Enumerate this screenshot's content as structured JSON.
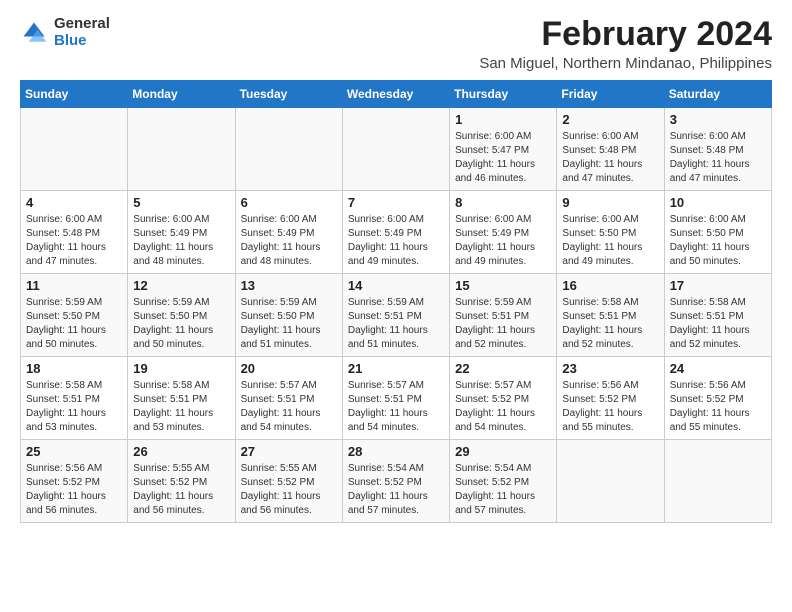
{
  "logo": {
    "general": "General",
    "blue": "Blue"
  },
  "header": {
    "title": "February 2024",
    "subtitle": "San Miguel, Northern Mindanao, Philippines"
  },
  "weekdays": [
    "Sunday",
    "Monday",
    "Tuesday",
    "Wednesday",
    "Thursday",
    "Friday",
    "Saturday"
  ],
  "weeks": [
    [
      {
        "day": "",
        "info": ""
      },
      {
        "day": "",
        "info": ""
      },
      {
        "day": "",
        "info": ""
      },
      {
        "day": "",
        "info": ""
      },
      {
        "day": "1",
        "info": "Sunrise: 6:00 AM\nSunset: 5:47 PM\nDaylight: 11 hours and 46 minutes."
      },
      {
        "day": "2",
        "info": "Sunrise: 6:00 AM\nSunset: 5:48 PM\nDaylight: 11 hours and 47 minutes."
      },
      {
        "day": "3",
        "info": "Sunrise: 6:00 AM\nSunset: 5:48 PM\nDaylight: 11 hours and 47 minutes."
      }
    ],
    [
      {
        "day": "4",
        "info": "Sunrise: 6:00 AM\nSunset: 5:48 PM\nDaylight: 11 hours and 47 minutes."
      },
      {
        "day": "5",
        "info": "Sunrise: 6:00 AM\nSunset: 5:49 PM\nDaylight: 11 hours and 48 minutes."
      },
      {
        "day": "6",
        "info": "Sunrise: 6:00 AM\nSunset: 5:49 PM\nDaylight: 11 hours and 48 minutes."
      },
      {
        "day": "7",
        "info": "Sunrise: 6:00 AM\nSunset: 5:49 PM\nDaylight: 11 hours and 49 minutes."
      },
      {
        "day": "8",
        "info": "Sunrise: 6:00 AM\nSunset: 5:49 PM\nDaylight: 11 hours and 49 minutes."
      },
      {
        "day": "9",
        "info": "Sunrise: 6:00 AM\nSunset: 5:50 PM\nDaylight: 11 hours and 49 minutes."
      },
      {
        "day": "10",
        "info": "Sunrise: 6:00 AM\nSunset: 5:50 PM\nDaylight: 11 hours and 50 minutes."
      }
    ],
    [
      {
        "day": "11",
        "info": "Sunrise: 5:59 AM\nSunset: 5:50 PM\nDaylight: 11 hours and 50 minutes."
      },
      {
        "day": "12",
        "info": "Sunrise: 5:59 AM\nSunset: 5:50 PM\nDaylight: 11 hours and 50 minutes."
      },
      {
        "day": "13",
        "info": "Sunrise: 5:59 AM\nSunset: 5:50 PM\nDaylight: 11 hours and 51 minutes."
      },
      {
        "day": "14",
        "info": "Sunrise: 5:59 AM\nSunset: 5:51 PM\nDaylight: 11 hours and 51 minutes."
      },
      {
        "day": "15",
        "info": "Sunrise: 5:59 AM\nSunset: 5:51 PM\nDaylight: 11 hours and 52 minutes."
      },
      {
        "day": "16",
        "info": "Sunrise: 5:58 AM\nSunset: 5:51 PM\nDaylight: 11 hours and 52 minutes."
      },
      {
        "day": "17",
        "info": "Sunrise: 5:58 AM\nSunset: 5:51 PM\nDaylight: 11 hours and 52 minutes."
      }
    ],
    [
      {
        "day": "18",
        "info": "Sunrise: 5:58 AM\nSunset: 5:51 PM\nDaylight: 11 hours and 53 minutes."
      },
      {
        "day": "19",
        "info": "Sunrise: 5:58 AM\nSunset: 5:51 PM\nDaylight: 11 hours and 53 minutes."
      },
      {
        "day": "20",
        "info": "Sunrise: 5:57 AM\nSunset: 5:51 PM\nDaylight: 11 hours and 54 minutes."
      },
      {
        "day": "21",
        "info": "Sunrise: 5:57 AM\nSunset: 5:51 PM\nDaylight: 11 hours and 54 minutes."
      },
      {
        "day": "22",
        "info": "Sunrise: 5:57 AM\nSunset: 5:52 PM\nDaylight: 11 hours and 54 minutes."
      },
      {
        "day": "23",
        "info": "Sunrise: 5:56 AM\nSunset: 5:52 PM\nDaylight: 11 hours and 55 minutes."
      },
      {
        "day": "24",
        "info": "Sunrise: 5:56 AM\nSunset: 5:52 PM\nDaylight: 11 hours and 55 minutes."
      }
    ],
    [
      {
        "day": "25",
        "info": "Sunrise: 5:56 AM\nSunset: 5:52 PM\nDaylight: 11 hours and 56 minutes."
      },
      {
        "day": "26",
        "info": "Sunrise: 5:55 AM\nSunset: 5:52 PM\nDaylight: 11 hours and 56 minutes."
      },
      {
        "day": "27",
        "info": "Sunrise: 5:55 AM\nSunset: 5:52 PM\nDaylight: 11 hours and 56 minutes."
      },
      {
        "day": "28",
        "info": "Sunrise: 5:54 AM\nSunset: 5:52 PM\nDaylight: 11 hours and 57 minutes."
      },
      {
        "day": "29",
        "info": "Sunrise: 5:54 AM\nSunset: 5:52 PM\nDaylight: 11 hours and 57 minutes."
      },
      {
        "day": "",
        "info": ""
      },
      {
        "day": "",
        "info": ""
      }
    ]
  ]
}
